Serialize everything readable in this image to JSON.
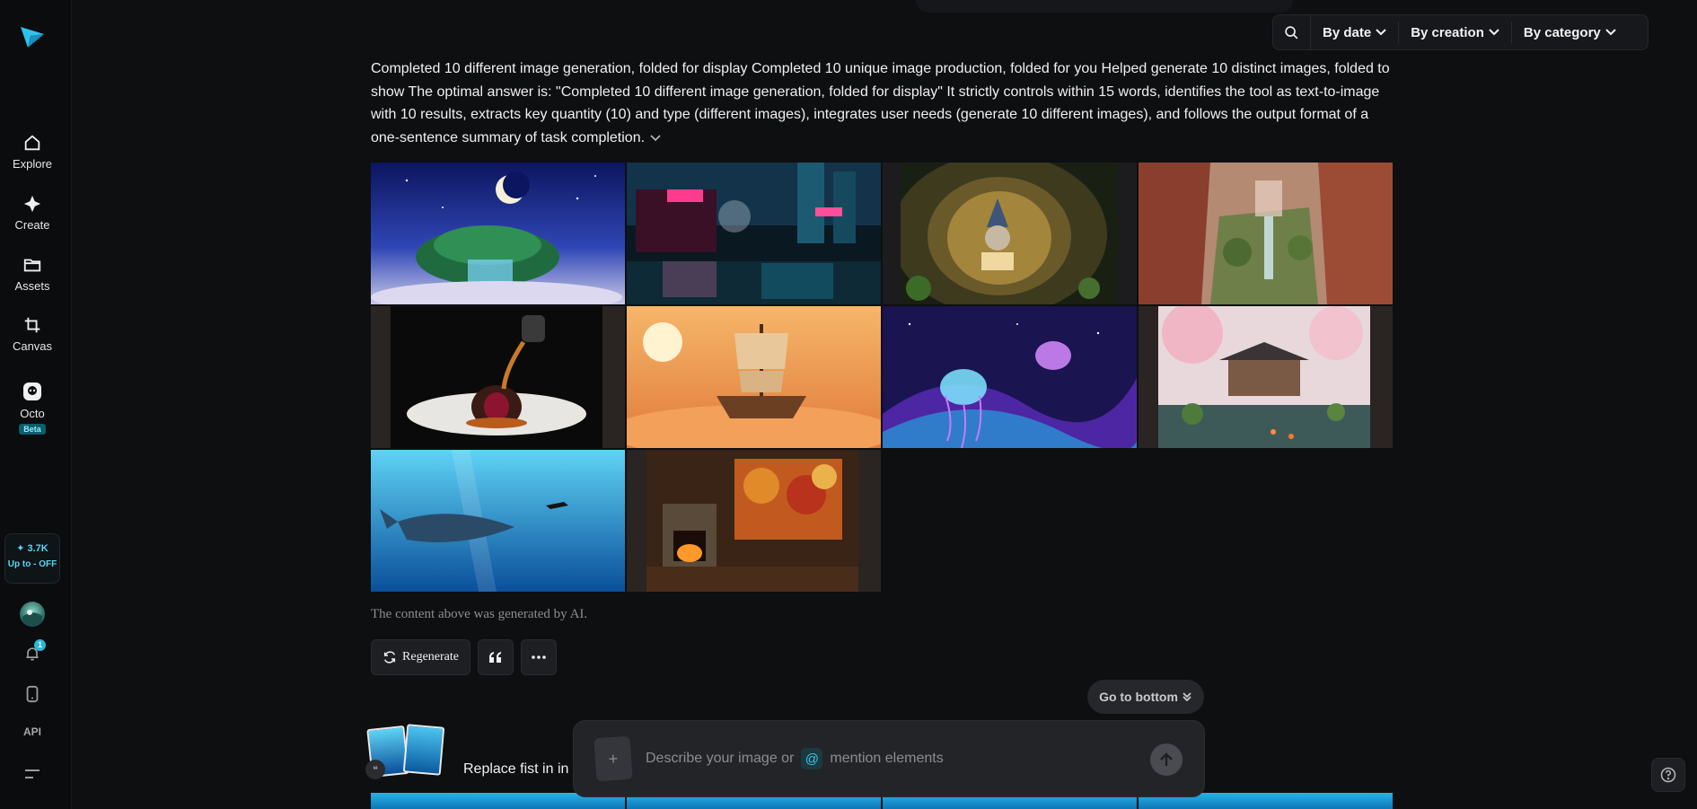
{
  "sidebar": {
    "logo_icon": "paper-plane-logo-icon",
    "items": [
      {
        "label": "Explore",
        "icon": "home-icon"
      },
      {
        "label": "Create",
        "icon": "diamond-icon"
      },
      {
        "label": "Assets",
        "icon": "folder-icon"
      },
      {
        "label": "Canvas",
        "icon": "crop-icon"
      },
      {
        "label": "Octo",
        "icon": "octo-icon",
        "badge": "Beta"
      }
    ],
    "credits": {
      "amount": "✦ 3.7K",
      "promo": "Up to - OFF"
    },
    "notifications": {
      "count": "1"
    },
    "api_label": "API"
  },
  "toolbar": {
    "search_icon": "search-icon",
    "filters": [
      "By date",
      "By creation",
      "By category"
    ]
  },
  "answer": {
    "text": "Completed 10 different image generation, folded for display Completed 10 unique image production, folded for you Helped generate 10 distinct images, folded to show The optimal answer is: \"Completed 10 different image generation, folded for display\" It strictly controls within 15 words, identifies the tool as text-to-image with 10 results, extracts key quantity (10) and type (different images), integrates user needs (generate 10 different images), and follows the output format of a one-sentence summary of task completion."
  },
  "images": [
    {
      "name": "floating-island-waterfall-moon"
    },
    {
      "name": "neon-ramen-street"
    },
    {
      "name": "wizard-mouse-reading"
    },
    {
      "name": "canyon-waterfall-ruins"
    },
    {
      "name": "chocolate-dessert-pour"
    },
    {
      "name": "sky-steampunk-ship"
    },
    {
      "name": "cosmic-jellyfish"
    },
    {
      "name": "japanese-house-sakura"
    },
    {
      "name": "whale-shark-diver"
    },
    {
      "name": "cabin-fireplace-autumn"
    }
  ],
  "disclaimer": "The content above was generated by AI.",
  "actions": {
    "regenerate_label": "Regenerate"
  },
  "go_to_bottom": "Go to bottom",
  "prompt": {
    "placeholder_before": "Describe your image or",
    "placeholder_after": "mention elements",
    "at_symbol": "@"
  },
  "history": {
    "text": "Replace fist in in"
  },
  "colors": {
    "accent": "#2ab7d6",
    "background": "#0e0f11",
    "panel": "#17181b"
  }
}
